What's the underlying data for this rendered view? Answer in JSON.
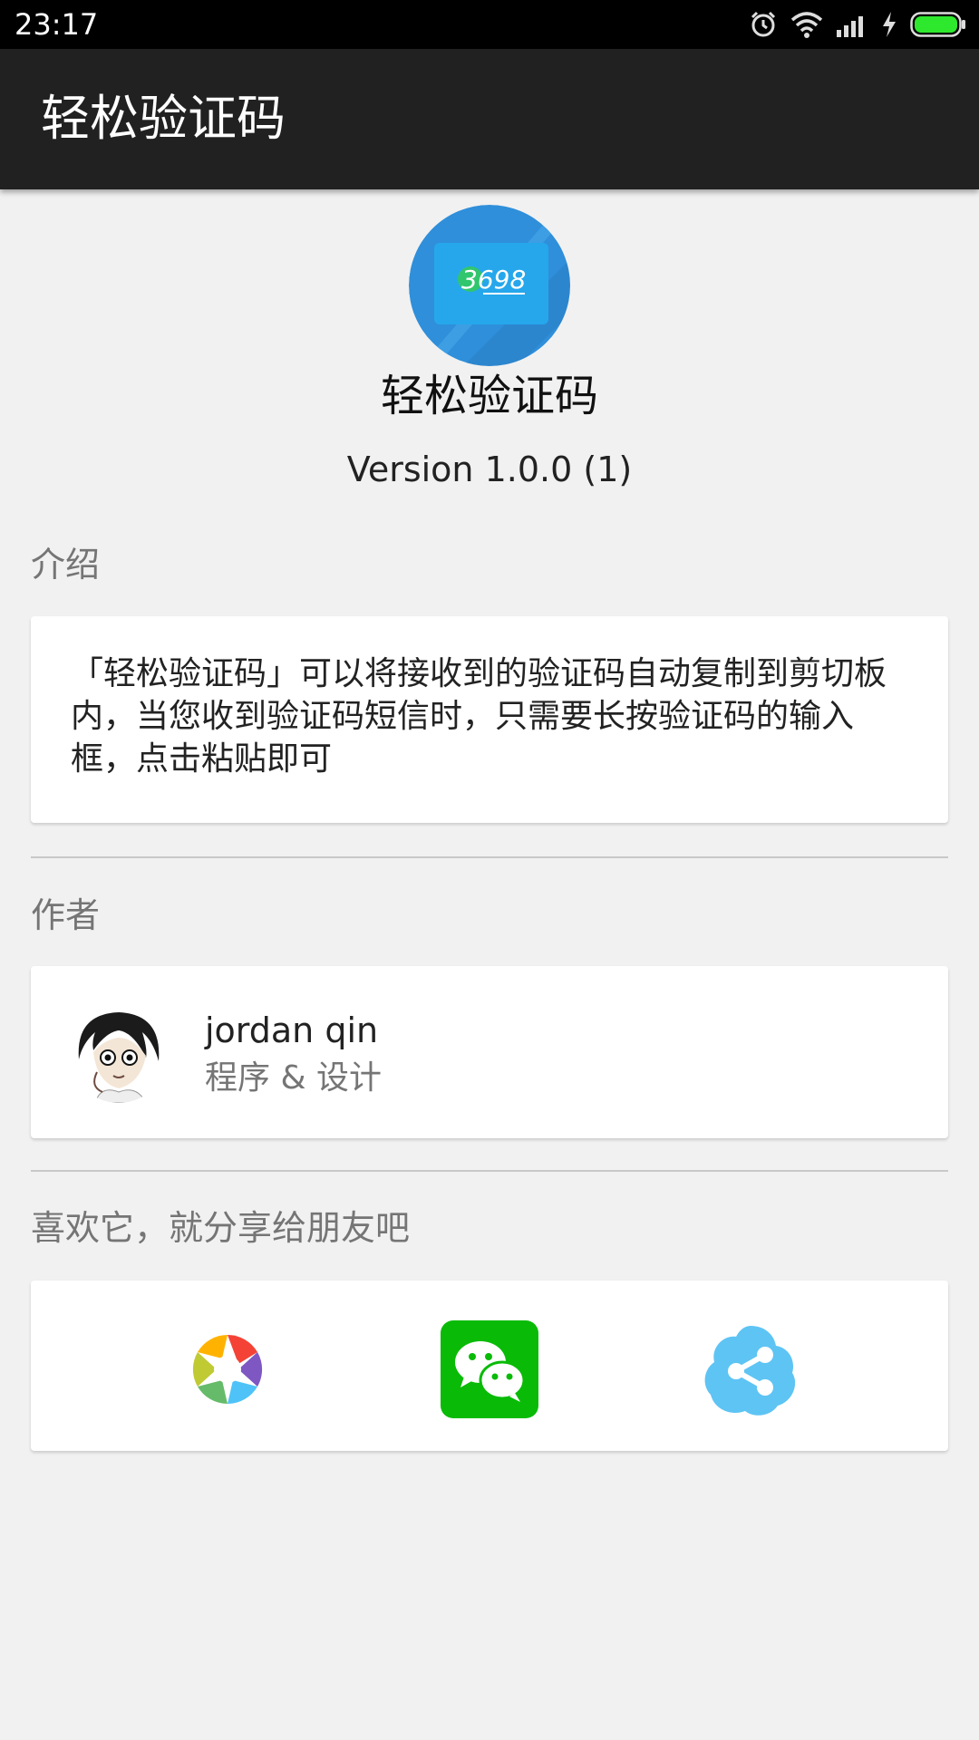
{
  "status_bar": {
    "time": "23:17",
    "icons": [
      "alarm-icon",
      "wifi-icon",
      "signal-icon",
      "charging-icon",
      "battery-icon"
    ],
    "battery_color": "#2ee82e"
  },
  "toolbar": {
    "title": "轻松验证码"
  },
  "app": {
    "logo_text": "3698",
    "name": "轻松验证码",
    "version": "Version 1.0.0 (1)"
  },
  "intro": {
    "section_title": "介绍",
    "text": "「轻松验证码」可以将接收到的验证码自动复制到剪切板内，当您收到验证码短信时，只需要长按验证码的输入框，点击粘贴即可"
  },
  "author": {
    "section_title": "作者",
    "name": "jordan qin",
    "role": "程序 & 设计"
  },
  "share": {
    "section_title": "喜欢它，就分享给朋友吧",
    "buttons": [
      {
        "icon": "moments-icon",
        "color": "multicolor"
      },
      {
        "icon": "wechat-icon",
        "color": "#09bb07"
      },
      {
        "icon": "share-icon",
        "color": "#4fc3f7"
      }
    ]
  }
}
